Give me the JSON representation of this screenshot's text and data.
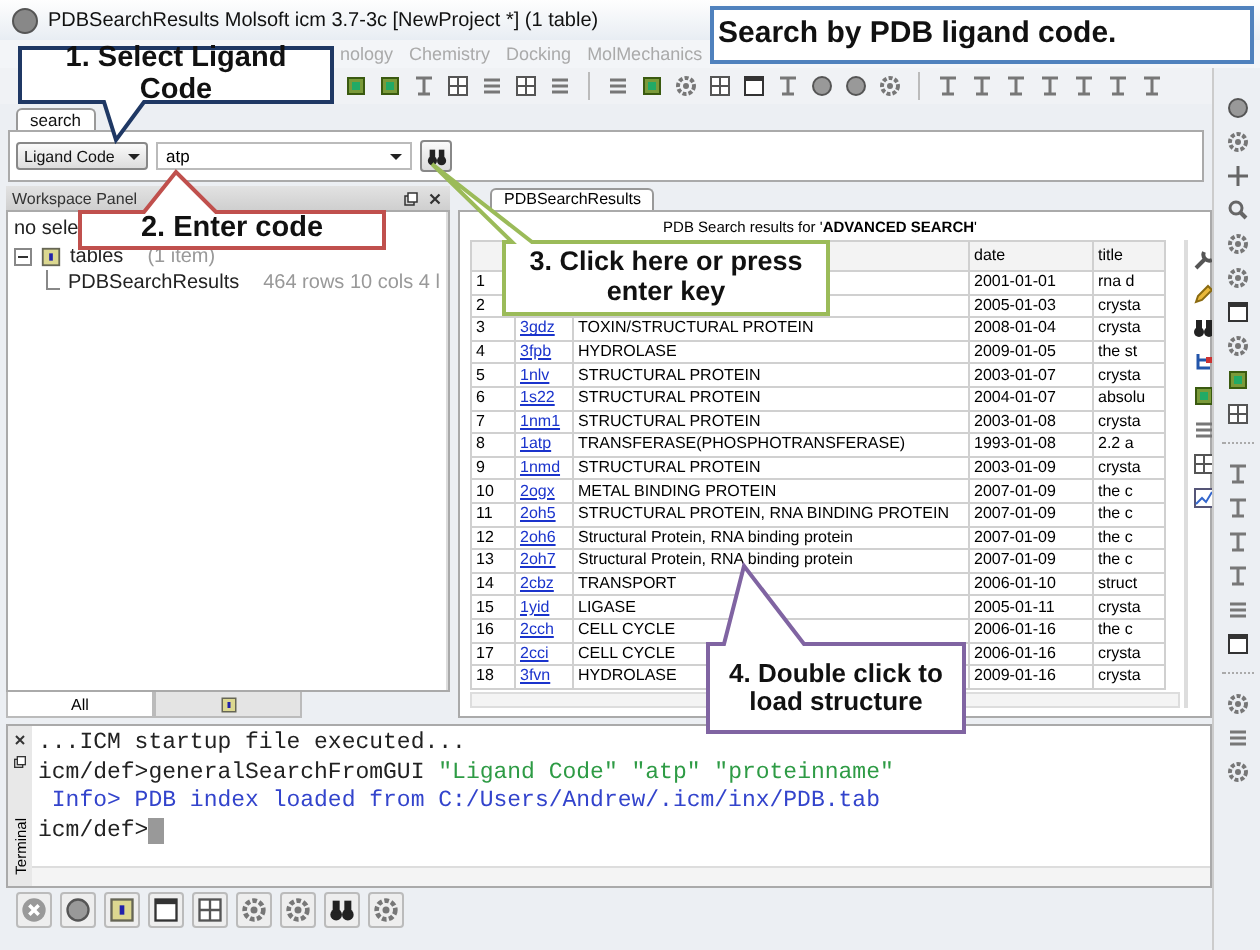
{
  "window": {
    "title": "PDBSearchResults Molsoft icm 3.7-3c  [NewProject *] (1 table)"
  },
  "menu": [
    "nology",
    "Chemistry",
    "Docking",
    "MolMechanics"
  ],
  "search_panel": {
    "tabs": [
      {
        "label": "search",
        "selected": true
      }
    ],
    "field_type": "Ligand Code",
    "query": "atp"
  },
  "workspace": {
    "title": "Workspace Panel",
    "filter": "no sele",
    "tree": [
      {
        "label": "tables",
        "note": "(1 item)",
        "expanded": true,
        "children": [
          {
            "label": "PDBSearchResults",
            "note": "464 rows 10 cols 4 l"
          }
        ]
      }
    ],
    "tabs": [
      {
        "label": "All",
        "selected": true
      }
    ]
  },
  "results": {
    "tabs": [
      {
        "label": "PDBSearchResults",
        "selected": true
      }
    ],
    "caption": "PDB Search results for '**ADVANCED SEARCH**'",
    "columns": [
      "date",
      "title"
    ],
    "rows": [
      {
        "n": "1",
        "date": "2001-01-01",
        "title": "rna d"
      },
      {
        "n": "2",
        "date": "2005-01-03",
        "title": "crysta"
      },
      {
        "n": "3",
        "id": "3gdz",
        "class": "TOXIN/STRUCTURAL PROTEIN",
        "date": "2008-01-04",
        "title": "crysta"
      },
      {
        "n": "4",
        "id": "3fpb",
        "class": "HYDROLASE",
        "date": "2009-01-05",
        "title": "the st"
      },
      {
        "n": "5",
        "id": "1nlv",
        "class": "STRUCTURAL PROTEIN",
        "date": "2003-01-07",
        "title": "crysta"
      },
      {
        "n": "6",
        "id": "1s22",
        "class": "STRUCTURAL PROTEIN",
        "date": "2004-01-07",
        "title": "absolu"
      },
      {
        "n": "7",
        "id": "1nm1",
        "class": "STRUCTURAL PROTEIN",
        "date": "2003-01-08",
        "title": "crysta"
      },
      {
        "n": "8",
        "id": "1atp",
        "class": "TRANSFERASE(PHOSPHOTRANSFERASE)",
        "date": "1993-01-08",
        "title": "2.2 a"
      },
      {
        "n": "9",
        "id": "1nmd",
        "class": "STRUCTURAL PROTEIN",
        "date": "2003-01-09",
        "title": "crysta"
      },
      {
        "n": "10",
        "id": "2ogx",
        "class": "METAL BINDING PROTEIN",
        "date": "2007-01-09",
        "title": "the c"
      },
      {
        "n": "11",
        "id": "2oh5",
        "class": "STRUCTURAL PROTEIN, RNA BINDING PROTEIN",
        "date": "2007-01-09",
        "title": "the c"
      },
      {
        "n": "12",
        "id": "2oh6",
        "class": "Structural Protein, RNA binding protein",
        "date": "2007-01-09",
        "title": "the c"
      },
      {
        "n": "13",
        "id": "2oh7",
        "class": "Structural Protein, RNA binding protein",
        "date": "2007-01-09",
        "title": "the c"
      },
      {
        "n": "14",
        "id": "2cbz",
        "class": "TRANSPORT",
        "date": "2006-01-10",
        "title": "struct"
      },
      {
        "n": "15",
        "id": "1yid",
        "class": "LIGASE",
        "date": "2005-01-11",
        "title": "crysta"
      },
      {
        "n": "16",
        "id": "2cch",
        "class": "CELL CYCLE",
        "date": "2006-01-16",
        "title": "the c"
      },
      {
        "n": "17",
        "id": "2cci",
        "class": "CELL CYCLE",
        "date": "2006-01-16",
        "title": "crysta"
      },
      {
        "n": "18",
        "id": "3fvn",
        "class": "HYDROLASE",
        "date": "2009-01-16",
        "title": "crysta"
      }
    ]
  },
  "terminal": {
    "label": "Terminal",
    "cursor": true,
    "lines": [
      {
        "segments": [
          {
            "kind": "output",
            "text": "...ICM startup file executed..."
          }
        ]
      },
      {
        "segments": [
          {
            "kind": "prompt",
            "text": "icm/def>generalSearchFromGUI "
          },
          {
            "kind": "string",
            "text": "\"Ligand Code\" \"atp\" \"proteinname\""
          }
        ]
      },
      {
        "segments": [
          {
            "kind": "info",
            "text": " Info> PDB index loaded from C:/Users/Andrew/.icm/inx/PDB.tab"
          }
        ]
      },
      {
        "segments": [
          {
            "kind": "prompt",
            "text": "icm/def>"
          }
        ]
      }
    ]
  },
  "callouts": [
    {
      "text": "Search by PDB ligand code.",
      "color": "#4f81bd"
    },
    {
      "text": "1. Select Ligand Code",
      "color": "#1f3864"
    },
    {
      "text": "2. Enter code",
      "color": "#c0504d"
    },
    {
      "text": "3. Click here or press enter key",
      "color": "#9bbb59"
    },
    {
      "text": "4. Double click to load structure",
      "color": "#8064a2"
    }
  ]
}
